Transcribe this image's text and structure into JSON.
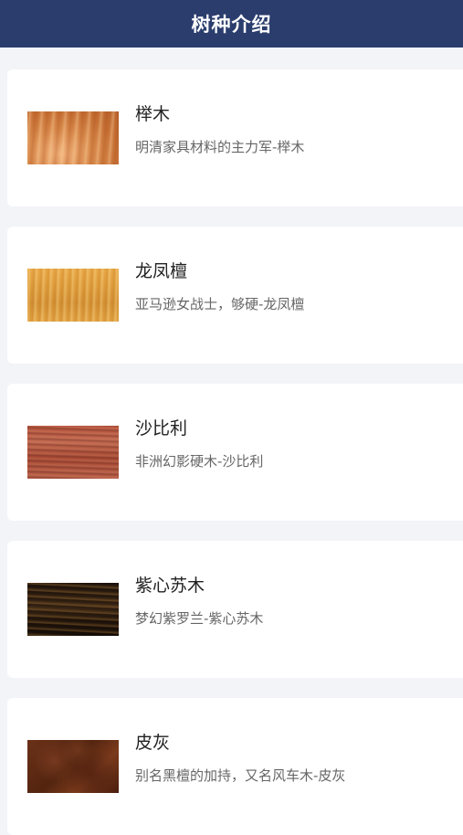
{
  "header": {
    "title": "树种介绍"
  },
  "woods": [
    {
      "name": "榉木",
      "desc": "明清家具材料的主力军-榉木",
      "texture": "beech"
    },
    {
      "name": "龙凤檀",
      "desc": "亚马逊女战士，够硬-龙凤檀",
      "texture": "padauk"
    },
    {
      "name": "沙比利",
      "desc": "非洲幻影硬木-沙比利",
      "texture": "sapele"
    },
    {
      "name": "紫心苏木",
      "desc": "梦幻紫罗兰-紫心苏木",
      "texture": "purpleheart"
    },
    {
      "name": "皮灰",
      "desc": "别名黑檀的加持，又名风车木-皮灰",
      "texture": "pihui"
    }
  ]
}
